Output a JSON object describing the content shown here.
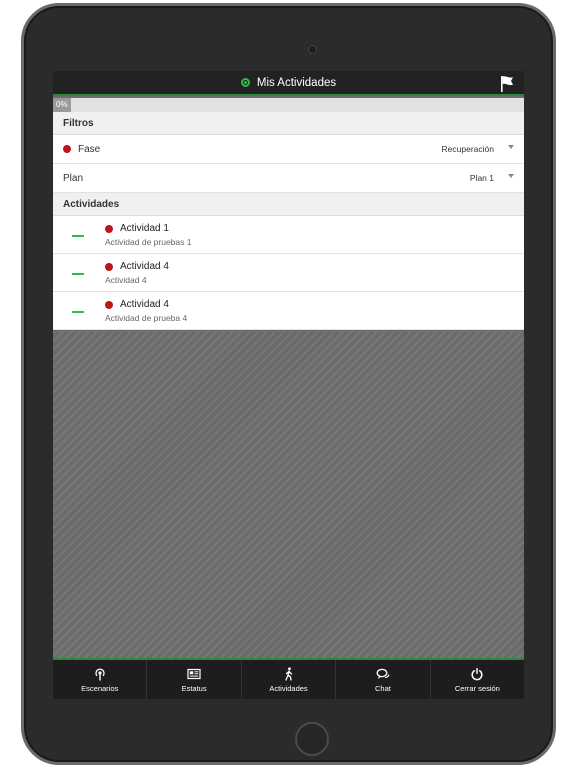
{
  "header": {
    "title": "Mis Actividades"
  },
  "progress": {
    "label": "0%",
    "value": 0
  },
  "filters": {
    "section_title": "Filtros",
    "fase": {
      "label": "Fase",
      "value": "Recuperación"
    },
    "plan": {
      "label": "Plan",
      "value": "Plan 1"
    }
  },
  "activities": {
    "section_title": "Actividades",
    "items": [
      {
        "title": "Actividad 1",
        "subtitle": "Actividad de pruebas 1"
      },
      {
        "title": "Actividad 4",
        "subtitle": "Actividad 4"
      },
      {
        "title": "Actividad 4",
        "subtitle": "Actividad de prueba 4"
      }
    ]
  },
  "tabs": [
    {
      "label": "Escenarios",
      "icon": "broadcast-icon"
    },
    {
      "label": "Estatus",
      "icon": "newspaper-icon"
    },
    {
      "label": "Actividades",
      "icon": "walking-icon"
    },
    {
      "label": "Chat",
      "icon": "chat-icon"
    },
    {
      "label": "Cerrar sesión",
      "icon": "power-icon"
    }
  ],
  "colors": {
    "accent_green": "#2dbb4a",
    "status_red": "#c0141c",
    "bar_dark": "#1d1d1d"
  }
}
